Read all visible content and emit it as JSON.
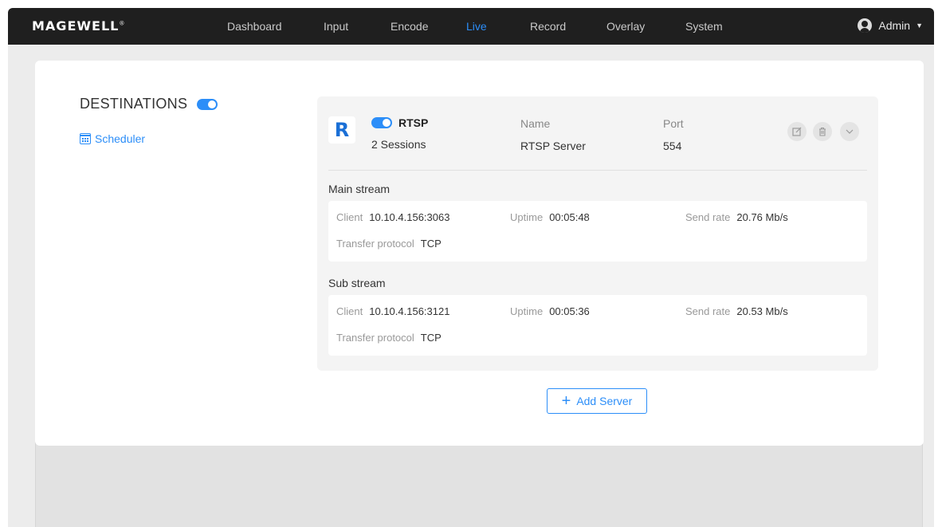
{
  "navbar": {
    "logo": "MAGEWELL",
    "logo_mark": "®",
    "items": [
      "Dashboard",
      "Input",
      "Encode",
      "Live",
      "Record",
      "Overlay",
      "System"
    ],
    "active": "Live",
    "user": "Admin"
  },
  "sidebar": {
    "title": "DESTINATIONS",
    "toggle_on": true,
    "scheduler": "Scheduler"
  },
  "server": {
    "logo_letter": "R",
    "protocol": "RTSP",
    "sessions": "2 Sessions",
    "name_label": "Name",
    "name_value": "RTSP Server",
    "port_label": "Port",
    "port_value": "554",
    "icons": [
      "edit-icon",
      "trash-icon",
      "chevron-down-icon"
    ]
  },
  "streams": [
    {
      "title": "Main stream",
      "client_label": "Client",
      "client": "10.10.4.156:3063",
      "uptime_label": "Uptime",
      "uptime": "00:05:48",
      "rate_label": "Send rate",
      "rate": "20.76 Mb/s",
      "protocol_label": "Transfer protocol",
      "protocol": "TCP"
    },
    {
      "title": "Sub stream",
      "client_label": "Client",
      "client": "10.10.4.156:3121",
      "uptime_label": "Uptime",
      "uptime": "00:05:36",
      "rate_label": "Send rate",
      "rate": "20.53 Mb/s",
      "protocol_label": "Transfer protocol",
      "protocol": "TCP"
    }
  ],
  "add_server": "Add Server",
  "colors": {
    "accent": "#2c8ef8",
    "navbar": "#1f1f1f",
    "logo_r": "#1a6fd6"
  }
}
